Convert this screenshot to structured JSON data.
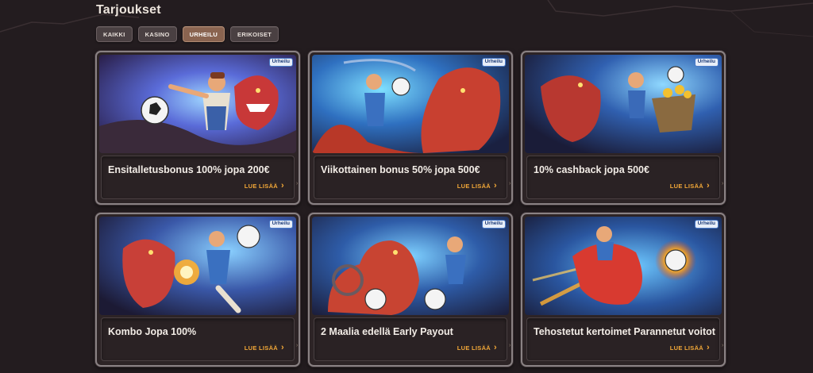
{
  "header": {
    "title": "Tarjoukset"
  },
  "filters": [
    {
      "label": "KAIKKI",
      "active": false
    },
    {
      "label": "KASINO",
      "active": false
    },
    {
      "label": "URHEILU",
      "active": true
    },
    {
      "label": "ERIKOISET",
      "active": false
    }
  ],
  "cards": [
    {
      "badge": "Urheilu",
      "title": "Ensitalletusbonus 100% jopa 200€",
      "link": "LUE LISÄÄ",
      "link_icon": "chevron-right-icon"
    },
    {
      "badge": "Urheilu",
      "title": "Viikottainen bonus 50% jopa 500€",
      "link": "LUE LISÄÄ",
      "link_icon": "chevron-right-icon"
    },
    {
      "badge": "Urheilu",
      "title": "10% cashback jopa 500€",
      "link": "LUE LISÄÄ",
      "link_icon": "chevron-right-icon"
    },
    {
      "badge": "Urheilu",
      "title": "Kombo Jopa 100%",
      "link": "LUE LISÄÄ",
      "link_icon": "chevron-right-icon"
    },
    {
      "badge": "Urheilu",
      "title": "2 Maalia edellä Early Payout",
      "link": "LUE LISÄÄ",
      "link_icon": "chevron-right-icon"
    },
    {
      "badge": "Urheilu",
      "title": "Tehostetut kertoimet Parannetut voitot",
      "link": "LUE LISÄÄ",
      "link_icon": "chevron-right-icon"
    }
  ],
  "colors": {
    "background": "#231c1f",
    "accent_link": "#f2a838",
    "active_filter": "#8a6450",
    "badge_text": "#1d3b78"
  }
}
